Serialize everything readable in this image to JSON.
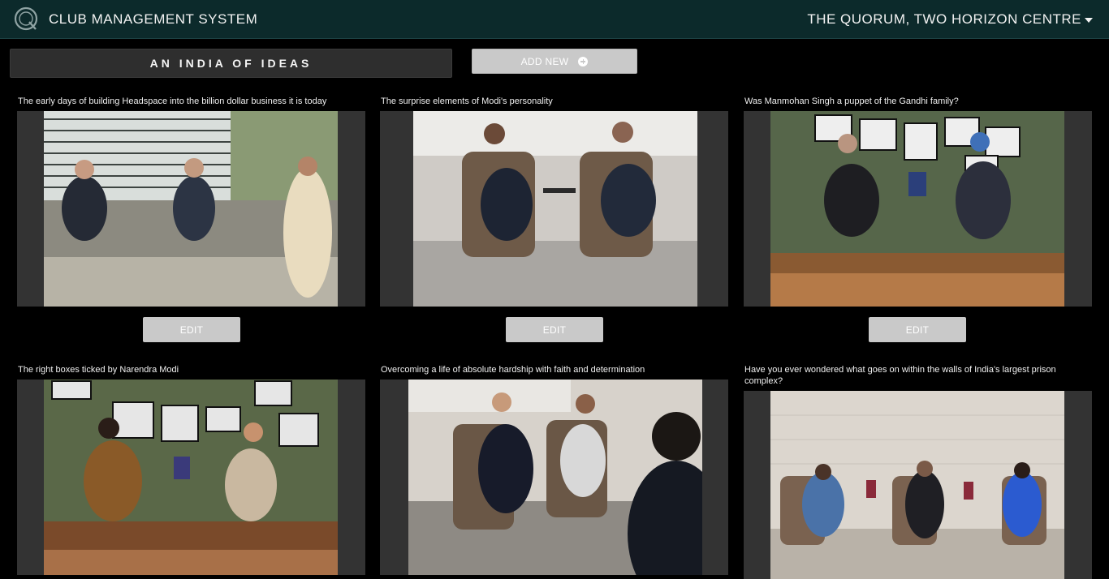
{
  "header": {
    "logo_letter": "Q",
    "app_title": "CLUB MANAGEMENT SYSTEM",
    "location": "THE QUORUM, TWO HORIZON CENTRE"
  },
  "category": {
    "title": "AN INDIA OF IDEAS"
  },
  "actions": {
    "add_new_label": "ADD NEW"
  },
  "cards": [
    {
      "title": "The early days of building Headspace into the billion dollar business it is today",
      "edit_label": "EDIT"
    },
    {
      "title": "The surprise elements of Modi's personality",
      "edit_label": "EDIT"
    },
    {
      "title": "Was Manmohan Singh a puppet of the Gandhi family?",
      "edit_label": "EDIT"
    },
    {
      "title": "The right boxes ticked by Narendra Modi"
    },
    {
      "title": "Overcoming a life of absolute hardship with faith and determination"
    },
    {
      "title": "Have you ever wondered what goes on within the walls of India's largest prison complex?"
    }
  ],
  "colors": {
    "header_bg": "#0c2a2b",
    "button_bg": "#c9c9c9",
    "frame_bg": "#333333"
  }
}
